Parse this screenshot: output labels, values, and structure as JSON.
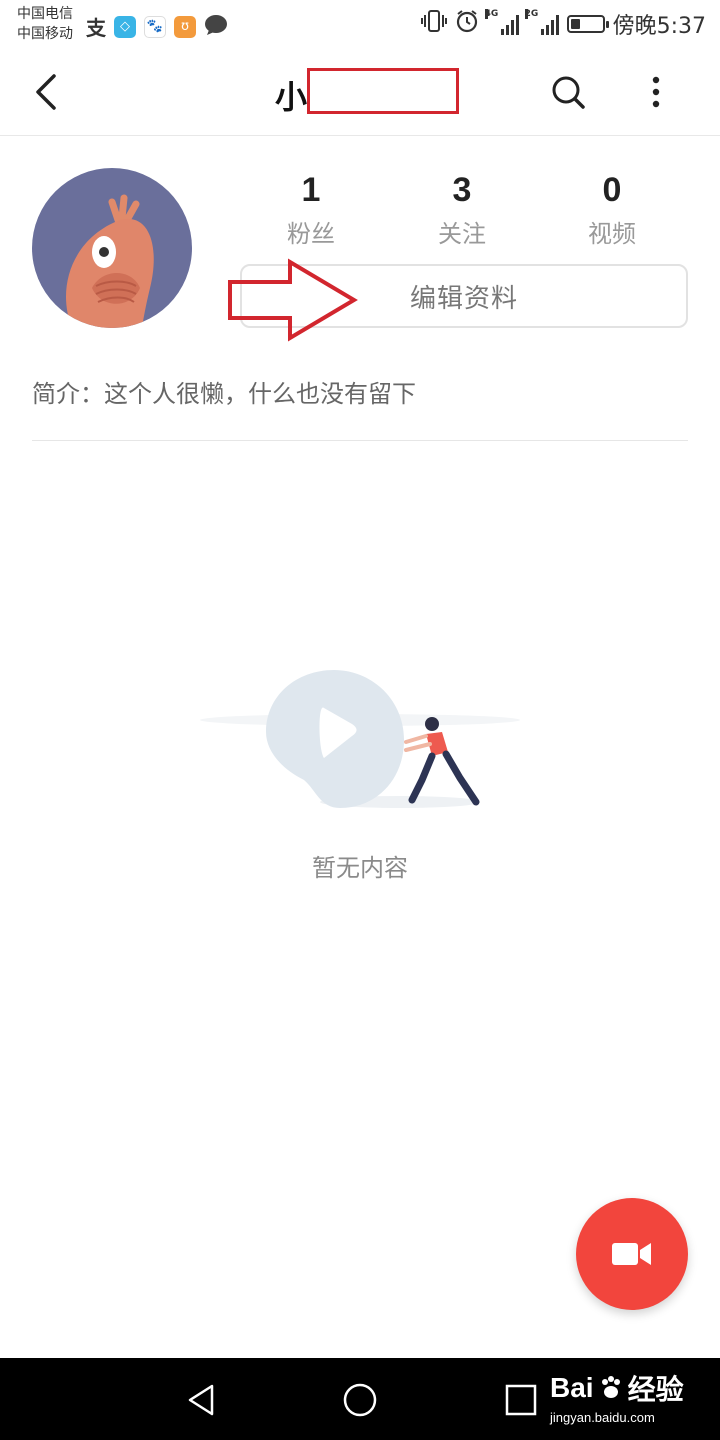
{
  "status_bar": {
    "carrier_1": "中国电信",
    "carrier_2": "中国移动",
    "net_tag_1": "4G",
    "net_tag_2": "2G",
    "time": "傍晚5:37",
    "battery_level": 0.3
  },
  "header": {
    "title": "小"
  },
  "profile": {
    "stats": [
      {
        "value": "1",
        "label": "粉丝"
      },
      {
        "value": "3",
        "label": "关注"
      },
      {
        "value": "0",
        "label": "视频"
      }
    ],
    "edit_label": "编辑资料",
    "bio": "简介：这个人很懒，什么也没有留下"
  },
  "empty_state": {
    "text": "暂无内容"
  },
  "watermark": {
    "logo_left": "Bai",
    "logo_right": "经验",
    "url": "jingyan.baidu.com"
  },
  "colors": {
    "accent": "#f2453d",
    "annotation": "#d2262e",
    "avatar_bg": "#6a6f9b"
  },
  "icons": [
    "back-arrow-icon",
    "search-icon",
    "more-vertical-icon",
    "video-camera-icon",
    "nav-back-icon",
    "nav-home-icon",
    "nav-recents-icon"
  ]
}
